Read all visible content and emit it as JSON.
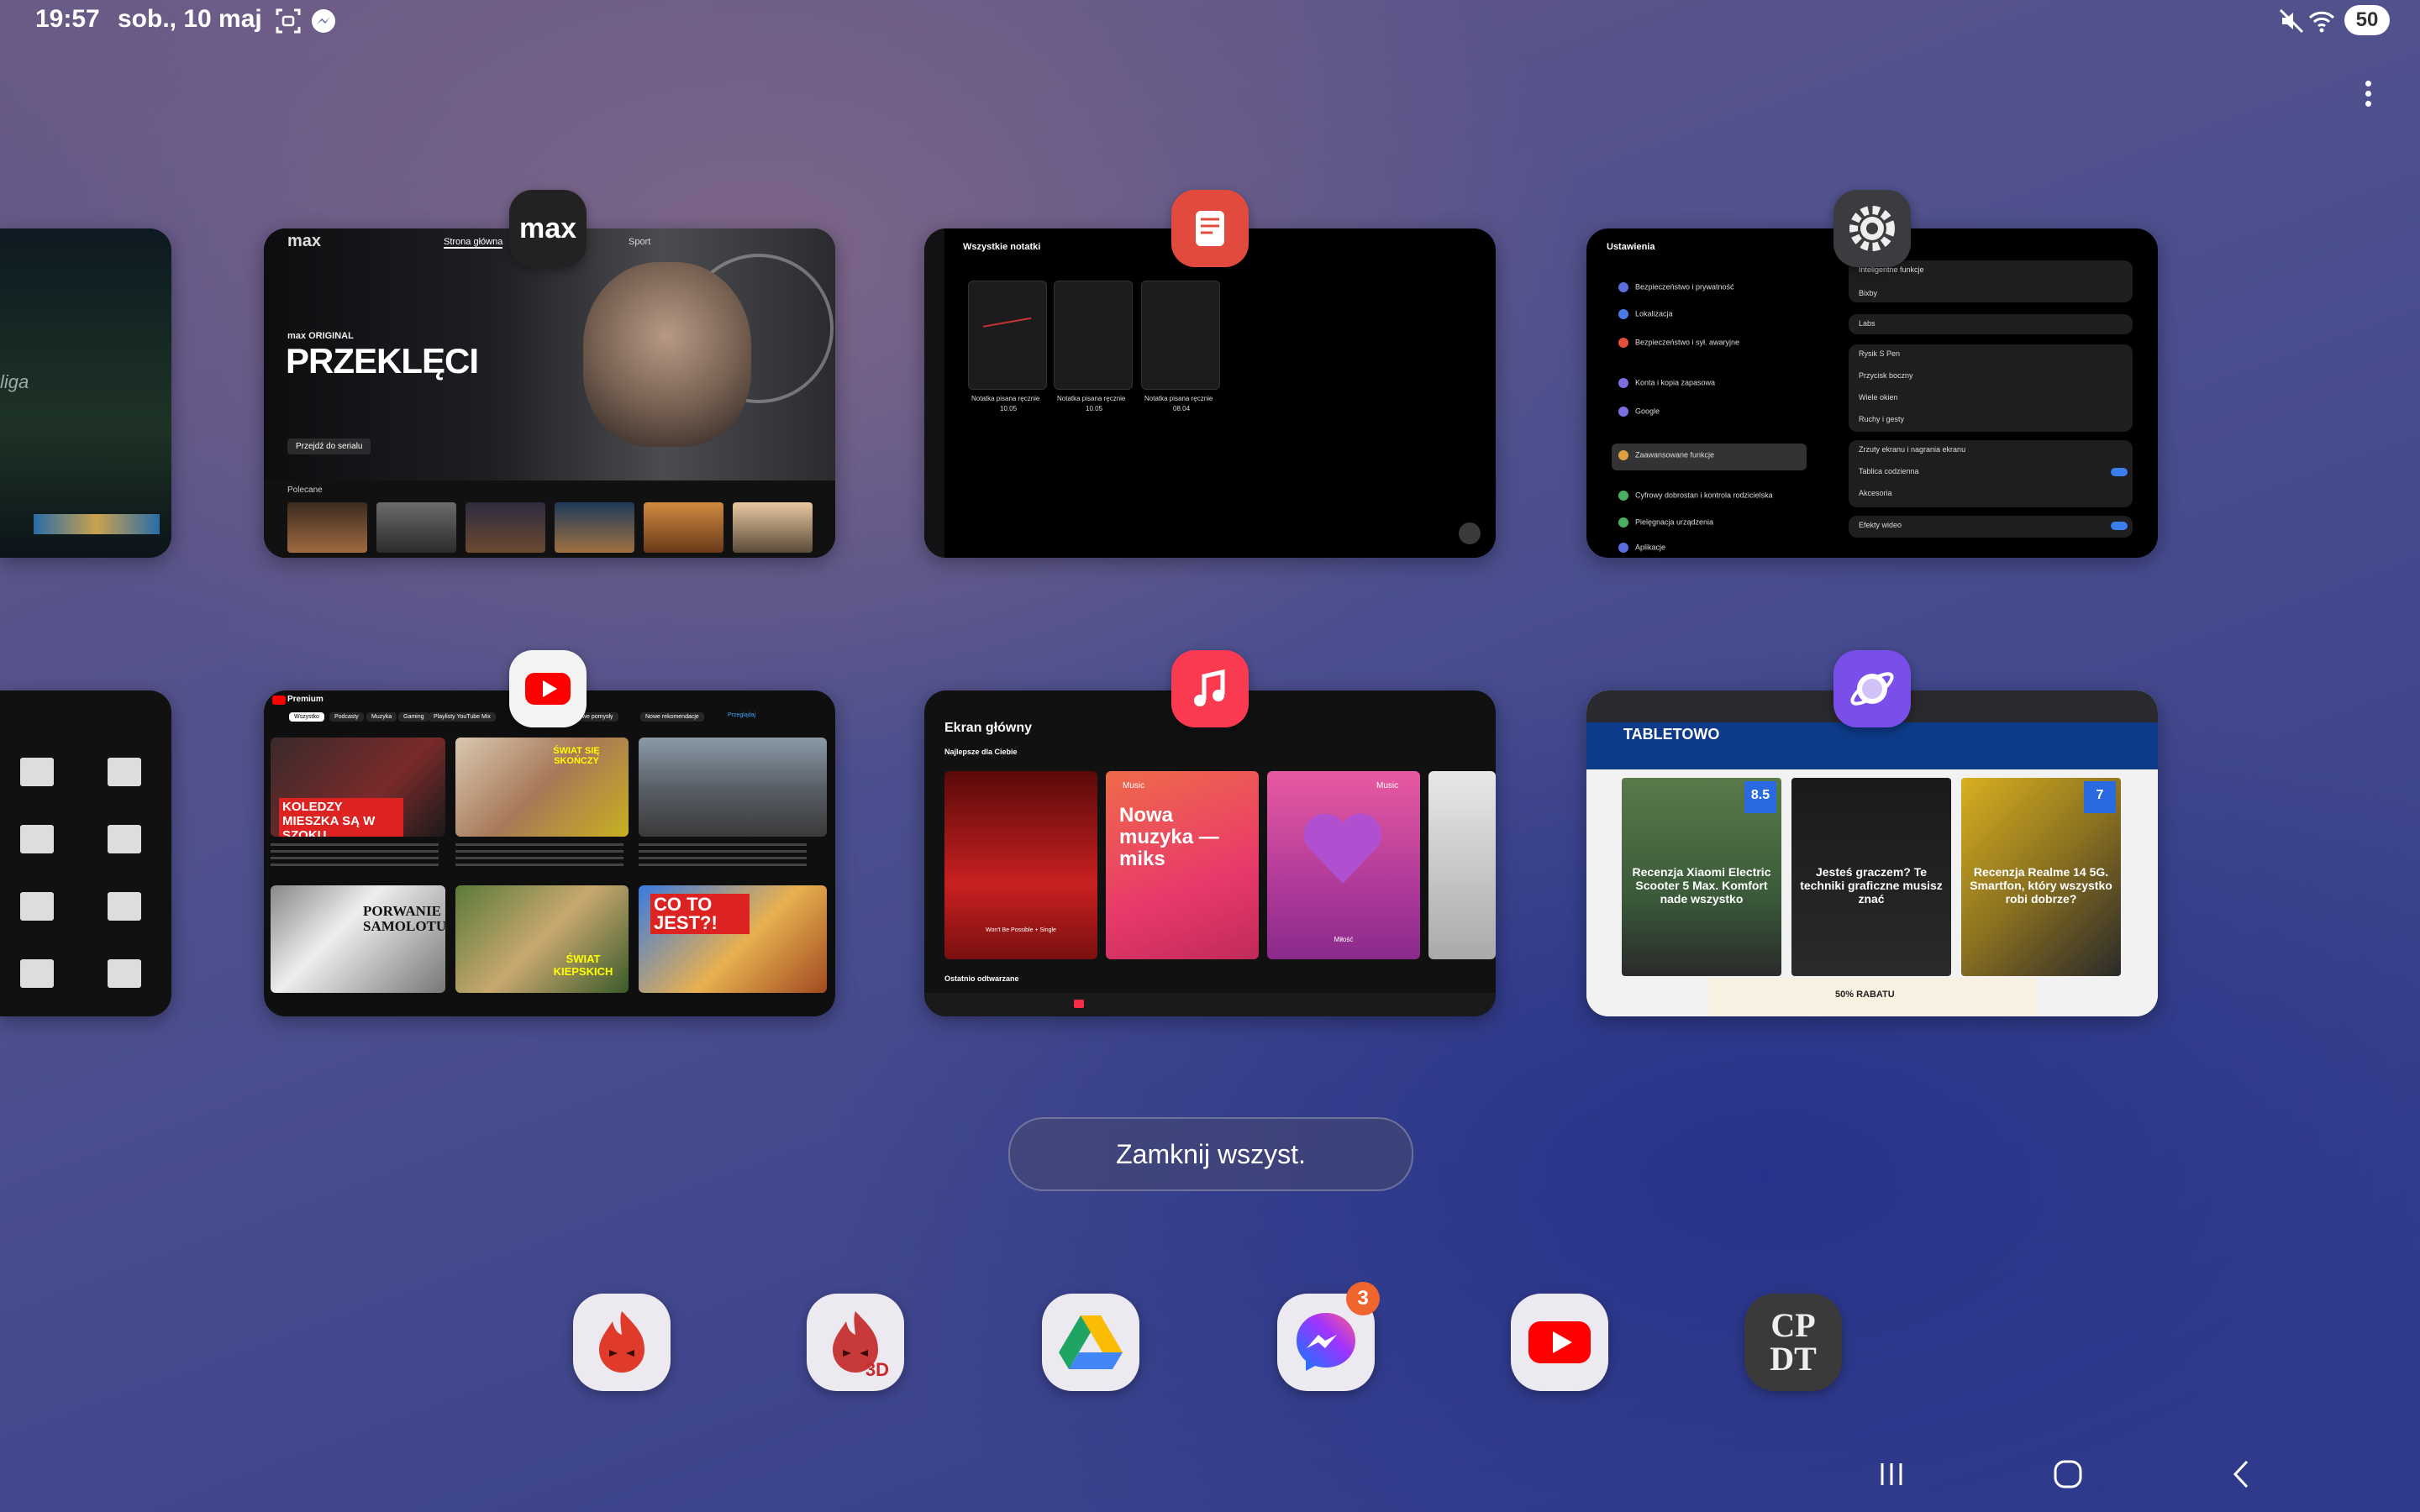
{
  "status_bar": {
    "time": "19:57",
    "date": "sob., 10 maj",
    "battery": "50",
    "icons": [
      "screenshot-icon",
      "messenger-icon",
      "mute-icon",
      "wifi-icon"
    ]
  },
  "recents": {
    "cards": [
      {
        "app": "max",
        "icon_text": "max",
        "nav": [
          "Strona główna",
          "Sport"
        ],
        "brand": "max",
        "badge": "max ORIGINAL",
        "title": "PRZEKLĘCI",
        "button": "Przejdź do serialu",
        "section": "Polecane"
      },
      {
        "app": "samsung-notes",
        "header": "Wszystkie notatki",
        "notes": [
          {
            "title": "Notatka pisana ręcznie",
            "date": "10.05"
          },
          {
            "title": "Notatka pisana ręcznie",
            "date": "10.05"
          },
          {
            "title": "Notatka pisana ręcznie",
            "date": "08.04"
          }
        ]
      },
      {
        "app": "settings",
        "header": "Ustawienia",
        "right_header": "nkcje",
        "left_items": [
          "Bezpieczeństwo i prywatność",
          "Lokalizacja",
          "Bezpieczeństwo i sył. awaryjne",
          "Konta i kopia zapasowa",
          "Google",
          "Zaawansowane funkcje",
          "Cyfrowy dobrostan i kontrola rodzicielska",
          "Pielęgnacja urządzenia",
          "Aplikacje"
        ],
        "right_items": [
          "Inteligentne funkcje",
          "Bixby",
          "Labs",
          "Rysik S Pen",
          "Przycisk boczny",
          "Wiele okien",
          "Ruchy i gesty",
          "Zrzuty ekranu i nagrania ekranu",
          "Tablica codzienna",
          "Akcesoria",
          "Efekty wideo"
        ]
      },
      {
        "app": "youtube",
        "brand": "Premium",
        "chips": [
          "Wszystko",
          "Podcasty",
          "Muzyka",
          "Gaming",
          "Playlisty YouTube Mix",
          "Nowe pomysły",
          "Nowe rekomendacje",
          "Przeglądaj"
        ],
        "thumbs": [
          {
            "text": "KOLEDZY MIESZKA SĄ W SZOKU"
          },
          {
            "text": "ŚWIAT SIĘ SKOŃCZY"
          },
          {
            "text": ""
          },
          {
            "text": "PORWANIE SAMOLOTU"
          },
          {
            "text": "ŚWIAT KIEPSKICH"
          },
          {
            "text": "CO TO JEST?!"
          }
        ]
      },
      {
        "app": "music",
        "header": "Ekran główny",
        "section": "Najlepsze dla Ciebie",
        "tiles": [
          {
            "title": "Won't Be Possible + Single"
          },
          {
            "title": "Nowa muzyka — miks",
            "brand": "Music"
          },
          {
            "title": "Miłość",
            "brand": "Music"
          }
        ],
        "footer": "Ostatnio odtwarzane"
      },
      {
        "app": "internet",
        "site": "TABLETOWO",
        "tiles": [
          {
            "title": "Recenzja Xiaomi Electric Scooter 5 Max. Komfort nade wszystko",
            "score": "8.5"
          },
          {
            "title": "Jesteś graczem? Te techniki graficzne musisz znać",
            "score": ""
          },
          {
            "title": "Recenzja Realme 14 5G. Smartfon, który wszystko robi dobrze?",
            "score": "7"
          }
        ],
        "ad": "50% RABATU"
      }
    ],
    "partial_left": {
      "text": "liga"
    },
    "close_all": "Zamknij wszyst."
  },
  "dock": {
    "apps": [
      {
        "name": "AnTuTu",
        "icon": "antutu-icon"
      },
      {
        "name": "AnTuTu 3D",
        "icon": "antutu-3d-icon",
        "label": "3D"
      },
      {
        "name": "Dysk Google",
        "icon": "google-drive-icon"
      },
      {
        "name": "Messenger",
        "icon": "messenger-icon",
        "badge": "3"
      },
      {
        "name": "YouTube",
        "icon": "youtube-icon"
      },
      {
        "name": "CPU-Z",
        "icon": "cpdt-icon",
        "label": "CP DT"
      }
    ]
  },
  "nav": [
    "recents-button",
    "home-button",
    "back-button"
  ]
}
